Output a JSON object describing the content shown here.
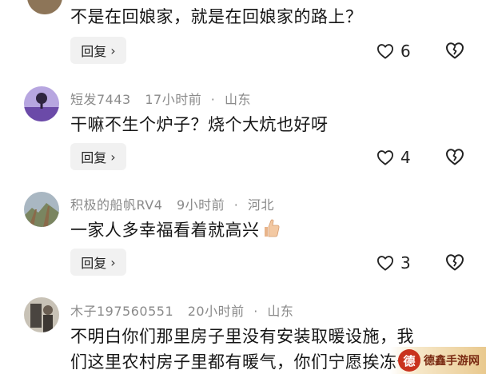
{
  "comments": [
    {
      "username": "",
      "time": "",
      "location": "",
      "text": "不是在回娘家，就是在回娘家的路上？",
      "reply_label": "回复",
      "likes": "6"
    },
    {
      "username": "短发7443",
      "time": "17小时前",
      "location": "山东",
      "text": "干嘛不生个炉子？烧个大炕也好呀",
      "reply_label": "回复",
      "likes": "4"
    },
    {
      "username": "积极的船帆RV4",
      "time": "9小时前",
      "location": "河北",
      "text": "一家人多幸福看着就高兴",
      "reply_label": "回复",
      "likes": "3"
    },
    {
      "username": "木子197560551",
      "time": "20小时前",
      "location": "山东",
      "text_line1": "不明白你们那里房子里没有安装取暖设施，我",
      "text_line2": "们这里农村房子里都有暖气，你们宁愿挨冻也"
    }
  ],
  "meta_separator": "·",
  "reply_chevron": "›",
  "watermark": {
    "seal": "德",
    "text": "德鑫手游网"
  },
  "icons": {
    "like": "heart-outline-icon",
    "dislike": "broken-heart-icon",
    "thumbs_up": "thumbs-up-emoji-icon"
  },
  "colors": {
    "meta_gray": "#8a8a8a",
    "reply_bg": "#f1f1f1",
    "text": "#161616"
  }
}
